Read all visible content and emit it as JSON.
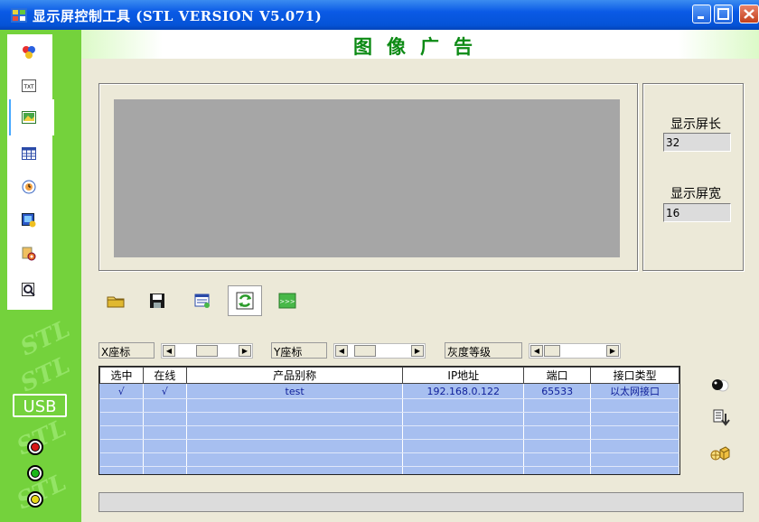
{
  "window": {
    "title": "显示屏控制工具 (STL VERSION V5.071)",
    "controls": [
      "minimize",
      "maximize",
      "close"
    ]
  },
  "sidebar": {
    "items": [
      {
        "icon": "colors-icon",
        "label": ""
      },
      {
        "icon": "txt-icon",
        "label": "TXT"
      },
      {
        "icon": "image-icon",
        "label": "",
        "active": true
      },
      {
        "icon": "table-icon",
        "label": ""
      },
      {
        "icon": "clock-icon",
        "label": ""
      },
      {
        "icon": "animation-icon",
        "label": ""
      },
      {
        "icon": "settings-icon",
        "label": ""
      },
      {
        "icon": "preview-icon",
        "label": ""
      }
    ],
    "usb_label": "USB",
    "leds": [
      {
        "name": "red-led",
        "color": "#d81818"
      },
      {
        "name": "green-led",
        "color": "#18b818"
      },
      {
        "name": "yellow-led",
        "color": "#e8d818"
      }
    ],
    "watermark": "STL"
  },
  "page": {
    "title": "图像广告"
  },
  "display": {
    "length_label": "显示屏长",
    "length_value": "32",
    "width_label": "显示屏宽",
    "width_value": "16"
  },
  "toolbar": {
    "items": [
      "open-folder-icon",
      "save-icon",
      "program-icon",
      "refresh-icon",
      "send-icon"
    ]
  },
  "sliders": {
    "x_label": "X座标",
    "y_label": "Y座标",
    "gray_label": "灰度等级"
  },
  "table": {
    "columns": [
      "选中",
      "在线",
      "产品别称",
      "IP地址",
      "端口",
      "接口类型"
    ],
    "rows": [
      [
        "√",
        "√",
        "test",
        "192.168.0.122",
        "65533",
        "以太网接口"
      ]
    ]
  },
  "right_icons": [
    "toggle-icon",
    "download-icon",
    "network-icon"
  ],
  "colors": {
    "sidebar": "#74d23c",
    "title_bar": "#0553d6",
    "page_title": "#0c8a14",
    "table_bg": "#a7bff0"
  }
}
